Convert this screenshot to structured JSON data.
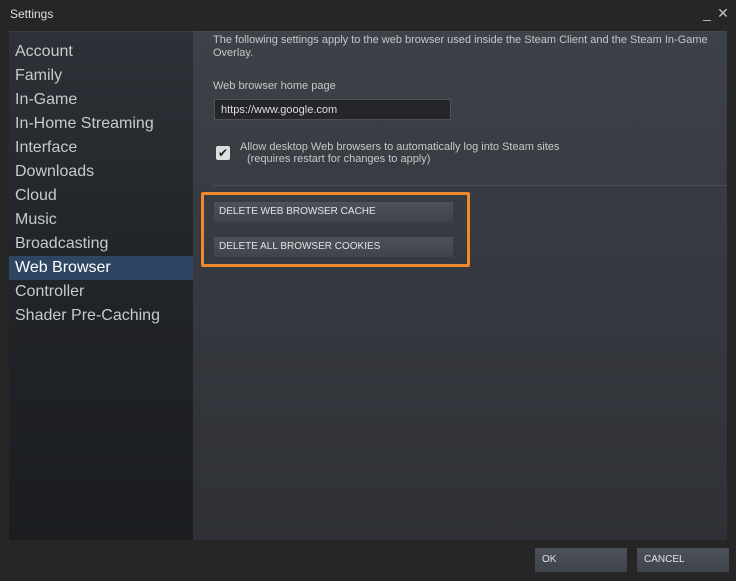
{
  "window": {
    "title": "Settings",
    "minimize_glyph": "_",
    "close_glyph": "✕"
  },
  "sidebar": {
    "items": [
      {
        "label": "Account"
      },
      {
        "label": "Family"
      },
      {
        "label": "In-Game"
      },
      {
        "label": "In-Home Streaming"
      },
      {
        "label": "Interface"
      },
      {
        "label": "Downloads"
      },
      {
        "label": "Cloud"
      },
      {
        "label": "Music"
      },
      {
        "label": "Broadcasting"
      },
      {
        "label": "Web Browser",
        "active": true
      },
      {
        "label": "Controller"
      },
      {
        "label": "Shader Pre-Caching"
      }
    ]
  },
  "web_browser": {
    "description_line1": "The following settings apply to the web browser used inside the Steam Client and the Steam In-Game",
    "description_line2": "Overlay.",
    "home_page_label": "Web browser home page",
    "home_page_value": "https://www.google.com",
    "auto_login_checked": true,
    "check_glyph": "✔",
    "auto_login_label": "Allow desktop Web browsers to automatically log into Steam sites",
    "auto_login_note": "(requires restart for changes to apply)",
    "delete_cache_label": "DELETE WEB BROWSER CACHE",
    "delete_cookies_label": "DELETE ALL BROWSER COOKIES"
  },
  "footer": {
    "ok_label": "OK",
    "cancel_label": "CANCEL"
  },
  "colors": {
    "highlight": "#ee8a2e",
    "active_nav": "#2f4662"
  }
}
